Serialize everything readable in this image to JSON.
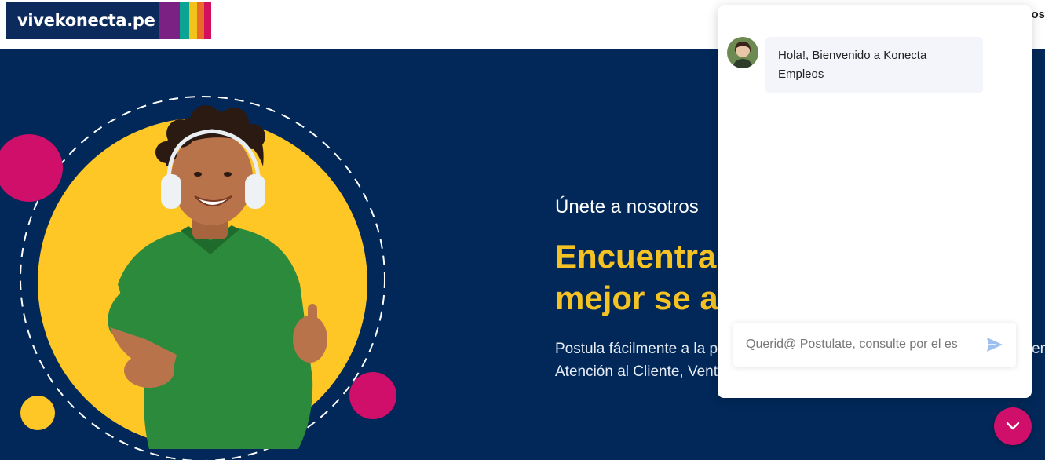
{
  "header": {
    "logo_text": "vivekonecta.pe",
    "logo_stripe_colors": [
      "#7b2183",
      "#0aa394",
      "#f3c21b",
      "#ea6a27",
      "#d4105e"
    ],
    "nav_partial": "eos"
  },
  "hero": {
    "subtitle": "Únete a nosotros",
    "title_line1": "Encuentra",
    "title_line2": "mejor se a",
    "desc_line1": "Postula fácilmente a la p",
    "desc_line2": "Atención al Cliente, Vent",
    "desc_edge": "en",
    "colors": {
      "background": "#012858",
      "yellow": "#f4c323",
      "magenta": "#cf0f6a"
    }
  },
  "chat": {
    "greeting": "Hola!, Bienvenido a Konecta Empleos",
    "input_placeholder": "Querid@ Postulate, consulte por el es",
    "send_icon": "send-icon",
    "toggle_icon": "chevron-down-icon"
  }
}
